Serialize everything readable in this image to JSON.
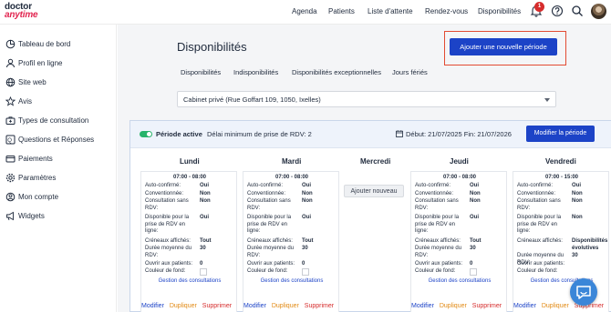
{
  "logo": {
    "line1": "doctor",
    "line2": "anytime"
  },
  "topnav": {
    "agenda": "Agenda",
    "patients": "Patients",
    "waitlist": "Liste d'attente",
    "appointments": "Rendez-vous",
    "availability": "Disponibilités",
    "notification_count": "1"
  },
  "sidebar": {
    "items": [
      {
        "label": "Tableau de bord",
        "icon": "pie-chart-icon"
      },
      {
        "label": "Profil en ligne",
        "icon": "user-icon"
      },
      {
        "label": "Site web",
        "icon": "globe-icon"
      },
      {
        "label": "Avis",
        "icon": "star-icon"
      },
      {
        "label": "Types de consultation",
        "icon": "medical-bag-icon"
      },
      {
        "label": "Questions et Réponses",
        "icon": "qa-icon"
      },
      {
        "label": "Paiements",
        "icon": "card-icon"
      },
      {
        "label": "Paramètres",
        "icon": "gear-icon"
      },
      {
        "label": "Mon compte",
        "icon": "account-icon"
      },
      {
        "label": "Widgets",
        "icon": "megaphone-icon"
      }
    ]
  },
  "main": {
    "title": "Disponibilités",
    "add_button": "Ajouter une nouvelle période",
    "tabs": [
      "Disponibilités",
      "Indisponibilités",
      "Disponibilités exceptionnelles",
      "Jours fériés"
    ],
    "location_select": "Cabinet privé (Rue Goffart 109, 1050, Ixelles)"
  },
  "period": {
    "active_label": "Période active",
    "delay_text": "Délai minimum de prise de RDV: 2",
    "dates_text": "Début: 21/07/2025 Fin: 21/07/2026",
    "modify_button": "Modifier la période"
  },
  "slot_labels": {
    "auto": "Auto-confirmé:",
    "conv": "Conventionnée:",
    "noappt": "Consultation sans RDV:",
    "online": "Disponible pour la prise de RDV en ligne:",
    "creneaux": "Créneaux affichés:",
    "duree": "Durée moyenne du RDV:",
    "ouvrir": "Ouvrir aux patients:",
    "couleur": "Couleur de fond:",
    "gestion": "Gestion des consultations"
  },
  "actions": {
    "modify": "Modifier",
    "duplicate": "Dupliquer",
    "delete": "Supprimer"
  },
  "days": [
    {
      "name": "Lundi",
      "time": "07:00 - 08:00",
      "auto": "Oui",
      "conv": "Non",
      "noappt": "Non",
      "online": "Oui",
      "creneaux": "Tout",
      "duree": "30",
      "ouvrir": "0"
    },
    {
      "name": "Mardi",
      "time": "07:00 - 08:00",
      "auto": "Oui",
      "conv": "Non",
      "noappt": "Non",
      "online": "Oui",
      "creneaux": "Tout",
      "duree": "30",
      "ouvrir": "0"
    },
    {
      "name": "Mercredi",
      "add_label": "Ajouter nouveau"
    },
    {
      "name": "Jeudi",
      "time": "07:00 - 08:00",
      "auto": "Oui",
      "conv": "Non",
      "noappt": "Non",
      "online": "Oui",
      "creneaux": "Tout",
      "duree": "30",
      "ouvrir": "0"
    },
    {
      "name": "Vendredi",
      "time": "07:00 - 15:00",
      "auto": "Oui",
      "conv": "Non",
      "noappt": "Non",
      "online": "Non",
      "creneaux": "Disponibilités évolutives",
      "duree": "30",
      "ouvrir": ""
    }
  ],
  "colors": {
    "primary": "#1c43c7",
    "brand_red": "#e1244f",
    "active_green": "#27b36a",
    "highlight_border": "#e24b32"
  }
}
